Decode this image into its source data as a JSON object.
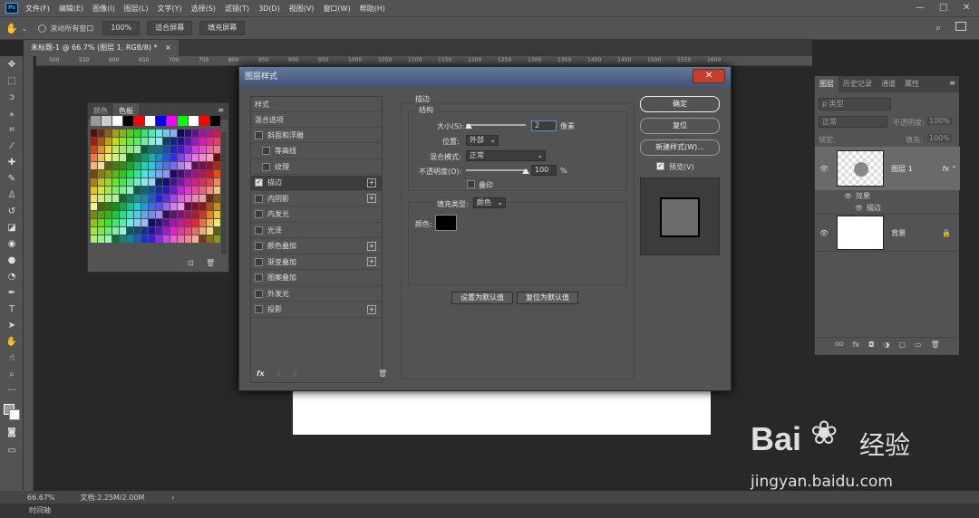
{
  "app": {
    "logo": "Ps",
    "menu": [
      "文件(F)",
      "编辑(E)",
      "图像(I)",
      "图层(L)",
      "文字(Y)",
      "选择(S)",
      "滤镜(T)",
      "3D(D)",
      "视图(V)",
      "窗口(W)",
      "帮助(H)"
    ],
    "window_controls": [
      "—",
      "□",
      "✕"
    ]
  },
  "options": {
    "scroll_all": "滚动所有窗口",
    "zoom": "100%",
    "fit_screen": "适合屏幕",
    "fill_screen": "填充屏幕"
  },
  "document": {
    "tab_title": "未标题-1 @ 66.7% (图层 1, RGB/8) *",
    "tab_close": "×"
  },
  "ruler_ticks": [
    "500",
    "550",
    "600",
    "650",
    "700",
    "750",
    "800",
    "850",
    "900",
    "950",
    "1000",
    "1050",
    "1100",
    "1150",
    "1200",
    "1250",
    "1300",
    "1350",
    "1400",
    "1450",
    "1500",
    "1550",
    "1600"
  ],
  "swatches_panel": {
    "tabs": [
      "颜色",
      "色板"
    ],
    "active_tab": "色板"
  },
  "dialog": {
    "title": "图层样式",
    "close": "✕",
    "styles_header": "样式",
    "blend_options": "混合选项",
    "styles": [
      {
        "label": "斜面和浮雕",
        "checked": false,
        "plus": false,
        "indent": false
      },
      {
        "label": "等高线",
        "checked": false,
        "plus": false,
        "indent": true
      },
      {
        "label": "纹理",
        "checked": false,
        "plus": false,
        "indent": true
      },
      {
        "label": "描边",
        "checked": true,
        "plus": true,
        "indent": false,
        "selected": true
      },
      {
        "label": "内阴影",
        "checked": false,
        "plus": true,
        "indent": false
      },
      {
        "label": "内发光",
        "checked": false,
        "plus": false,
        "indent": false
      },
      {
        "label": "光泽",
        "checked": false,
        "plus": false,
        "indent": false
      },
      {
        "label": "颜色叠加",
        "checked": false,
        "plus": true,
        "indent": false
      },
      {
        "label": "渐变叠加",
        "checked": false,
        "plus": true,
        "indent": false
      },
      {
        "label": "图案叠加",
        "checked": false,
        "plus": false,
        "indent": false
      },
      {
        "label": "外发光",
        "checked": false,
        "plus": false,
        "indent": false
      },
      {
        "label": "投影",
        "checked": false,
        "plus": true,
        "indent": false
      }
    ],
    "list_footer": {
      "fx": "fx",
      "up": "⇧",
      "down": "⇩",
      "trash": "🗑"
    },
    "stroke": {
      "title": "描边",
      "structure": "结构",
      "size_label": "大小(S):",
      "size_value": "2",
      "size_unit": "像素",
      "position_label": "位置:",
      "position_value": "外部",
      "blend_label": "混合模式:",
      "blend_value": "正常",
      "opacity_label": "不透明度(O):",
      "opacity_value": "100",
      "opacity_unit": "%",
      "overprint_label": "叠印",
      "fill_type_label": "填充类型:",
      "fill_type_value": "颜色",
      "color_label": "颜色:",
      "color": "#000000",
      "set_default": "设置为默认值",
      "reset_default": "复位为默认值"
    },
    "buttons": {
      "ok": "确定",
      "reset": "复位",
      "new_style": "新建样式(W)...",
      "preview": "预览(V)"
    }
  },
  "layers_panel": {
    "tabs": [
      "图层",
      "历史记录",
      "通道",
      "属性"
    ],
    "kind_filter": "ρ 类型",
    "blend_mode": "正常",
    "opacity_label": "不透明度:",
    "opacity_value": "100%",
    "lock_label": "锁定:",
    "fill_label": "填充:",
    "fill_value": "100%",
    "layer1": {
      "name": "图层 1",
      "fx": "fx"
    },
    "effects_label": "效果",
    "stroke_effect": "描边",
    "background": {
      "name": "背景"
    },
    "footer_icons": [
      "GO",
      "fx",
      "◘",
      "◑",
      "▢",
      "▭",
      "🗑"
    ]
  },
  "status": {
    "zoom": "66.67%",
    "doc": "文档:2.25M/2.00M",
    "arrow": "›"
  },
  "timeline": {
    "label": "时间轴"
  },
  "watermark": {
    "brand": "Bai",
    "brand_suffix": "经验",
    "url": "jingyan.baidu.com"
  }
}
